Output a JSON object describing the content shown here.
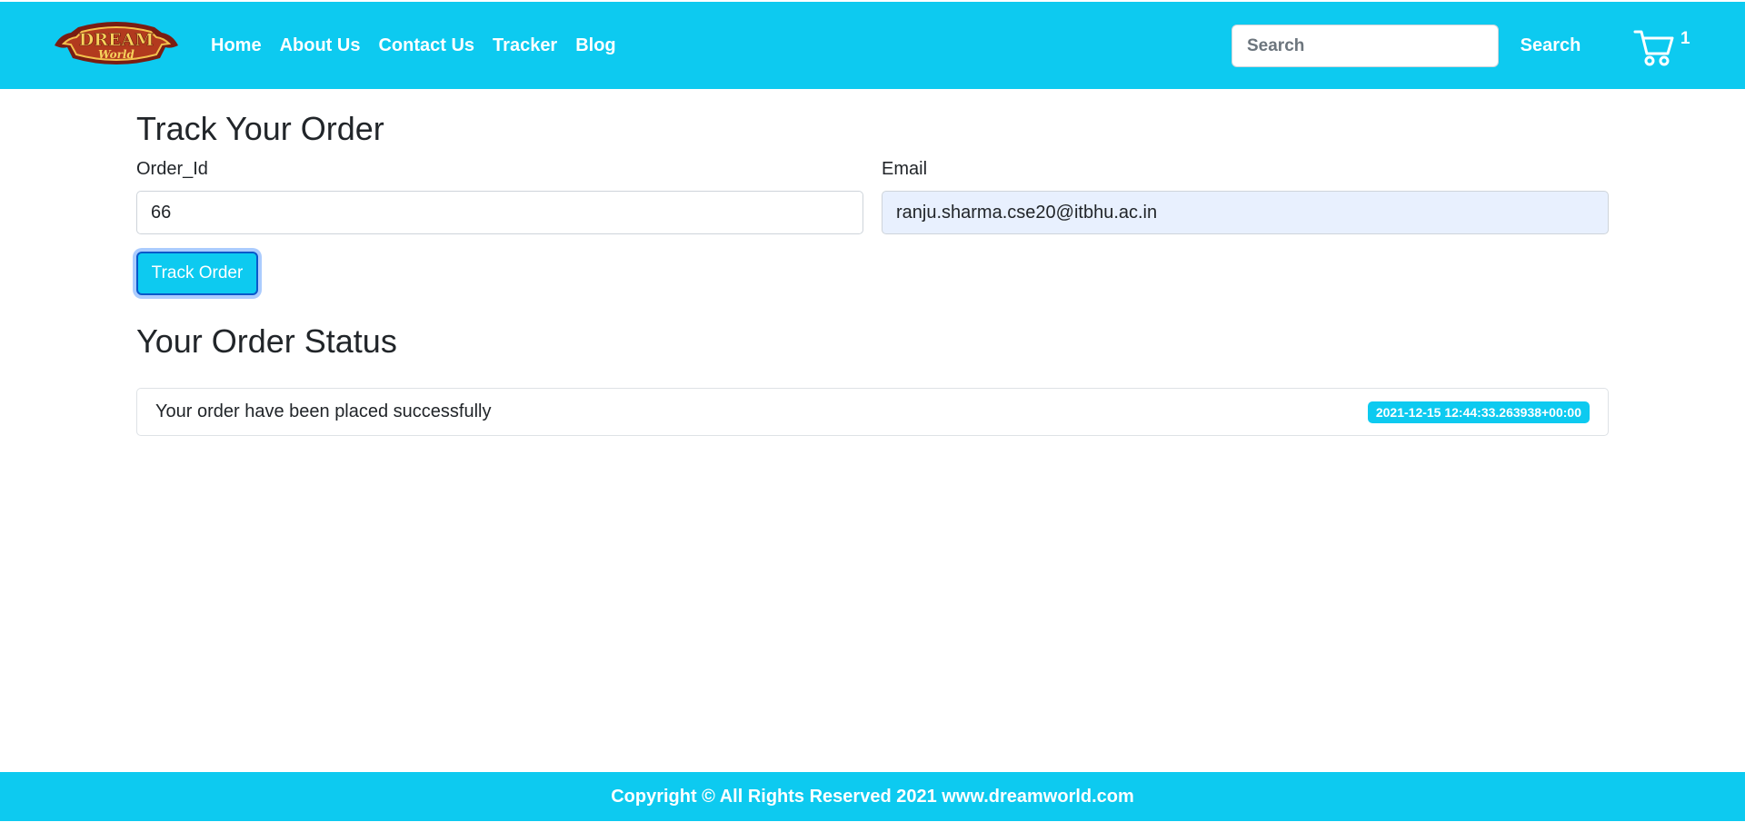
{
  "brand": {
    "logo_text_top": "DREAM",
    "logo_text_bottom": "World",
    "accent_color": "#0dcaf0"
  },
  "nav": {
    "links": [
      "Home",
      "About Us",
      "Contact Us",
      "Tracker",
      "Blog"
    ],
    "search_placeholder": "Search",
    "search_button": "Search",
    "cart_icon": "shopping-cart-icon",
    "cart_count": "1"
  },
  "tracker": {
    "title": "Track Your Order",
    "order_id_label": "Order_Id",
    "order_id_value": "66",
    "email_label": "Email",
    "email_value": "ranju.sharma.cse20@itbhu.ac.in",
    "submit_label": "Track Order"
  },
  "status": {
    "title": "Your Order Status",
    "items": [
      {
        "text": "Your order have been placed successfully",
        "timestamp": "2021-12-15 12:44:33.263938+00:00"
      }
    ]
  },
  "footer": {
    "text": "Copyright © All Rights Reserved 2021 www.dreamworld.com"
  }
}
